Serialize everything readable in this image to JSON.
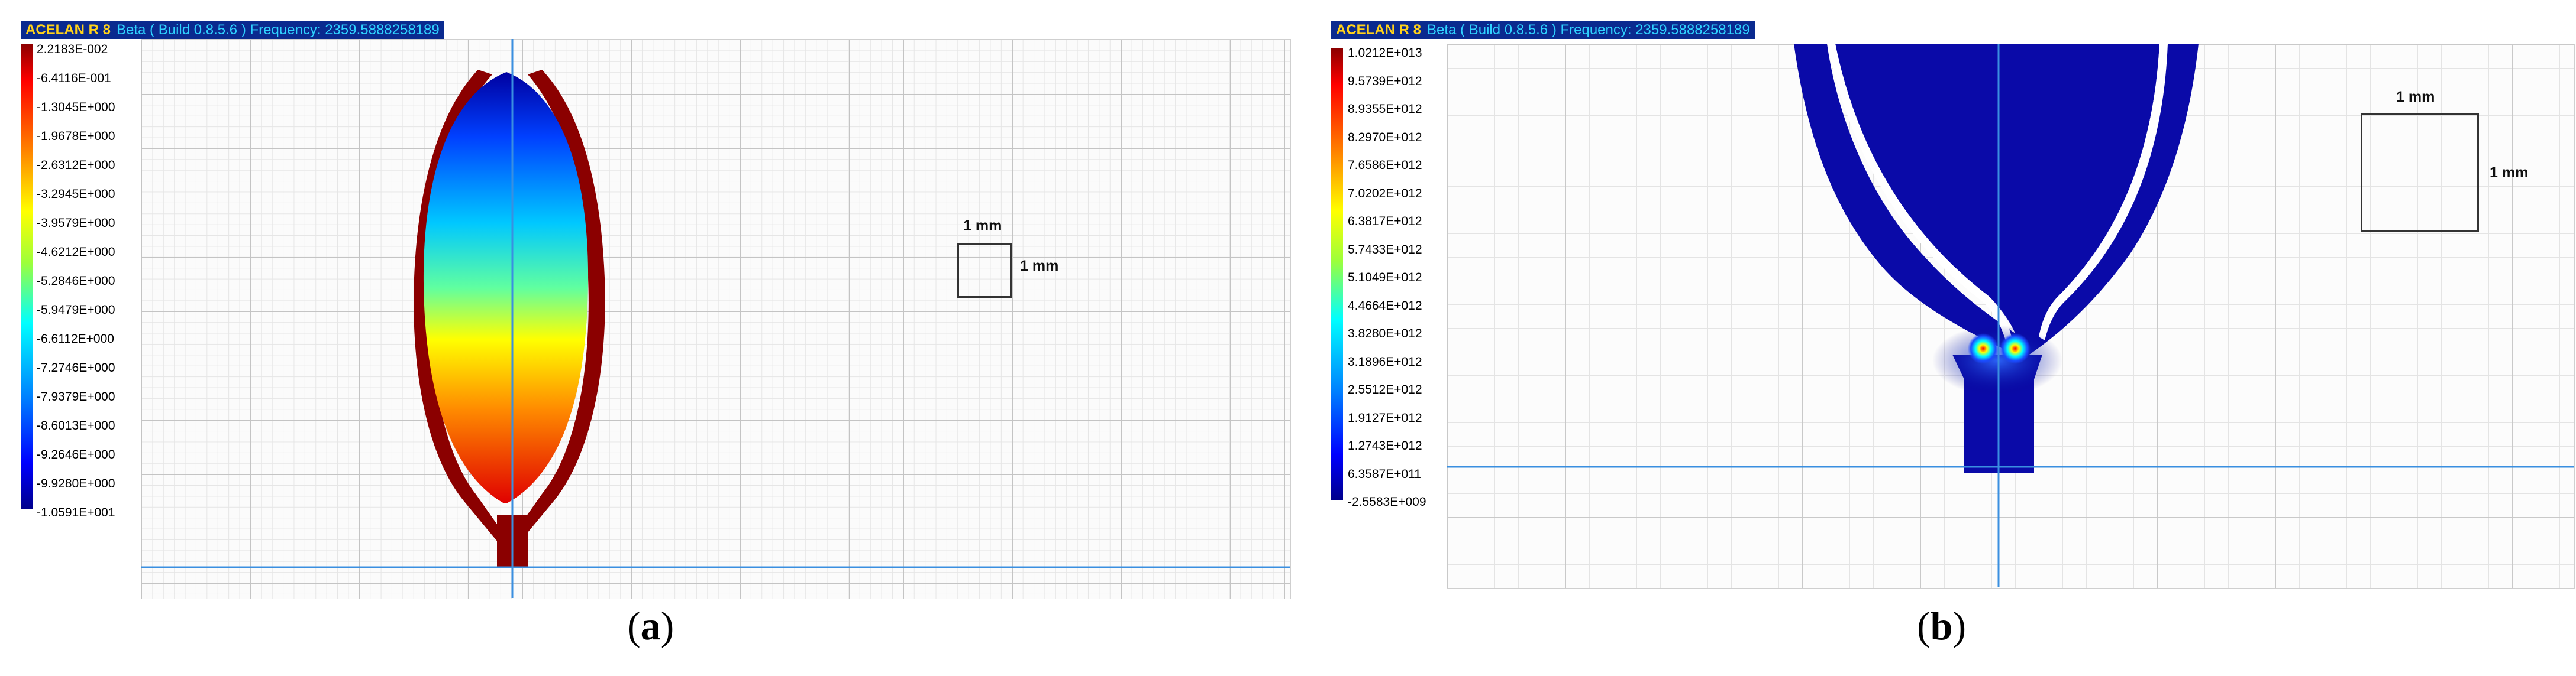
{
  "panel_a": {
    "title_app": "ACELAN R 8",
    "title_build": "Beta ( Build 0.8.5.6 ) Frequency: 2359.5888258189",
    "legend": [
      "2.2183E-002",
      "-6.4116E-001",
      "-1.3045E+000",
      "-1.9678E+000",
      "-2.6312E+000",
      "-3.2945E+000",
      "-3.9579E+000",
      "-4.6212E+000",
      "-5.2846E+000",
      "-5.9479E+000",
      "-6.6112E+000",
      "-7.2746E+000",
      "-7.9379E+000",
      "-8.6013E+000",
      "-9.2646E+000",
      "-9.9280E+000",
      "-1.0591E+001"
    ],
    "scale_label_h": "1 mm",
    "scale_label_v": "1 mm",
    "caption_open": "(",
    "caption_letter": "a",
    "caption_close": ")"
  },
  "panel_b": {
    "title_app": "ACELAN R 8",
    "title_build": "Beta ( Build 0.8.5.6 ) Frequency: 2359.5888258189",
    "legend": [
      "1.0212E+013",
      "9.5739E+012",
      "8.9355E+012",
      "8.2970E+012",
      "7.6586E+012",
      "7.0202E+012",
      "6.3817E+012",
      "5.7433E+012",
      "5.1049E+012",
      "4.4664E+012",
      "3.8280E+012",
      "3.1896E+012",
      "2.5512E+012",
      "1.9127E+012",
      "1.2743E+012",
      "6.3587E+011",
      "-2.5583E+009"
    ],
    "scale_label_h": "1 mm",
    "scale_label_v": "1 mm",
    "caption_open": "(",
    "caption_letter": "b",
    "caption_close": ")"
  },
  "colors": {
    "titlebar_bg": "#0a2a8f",
    "title_app": "#ffd21a",
    "title_build": "#2fd2ff",
    "frame_dark_red": "#8b0000",
    "field_dark_blue": "#00008b",
    "crosshair_blue": "#3a8fe0"
  }
}
